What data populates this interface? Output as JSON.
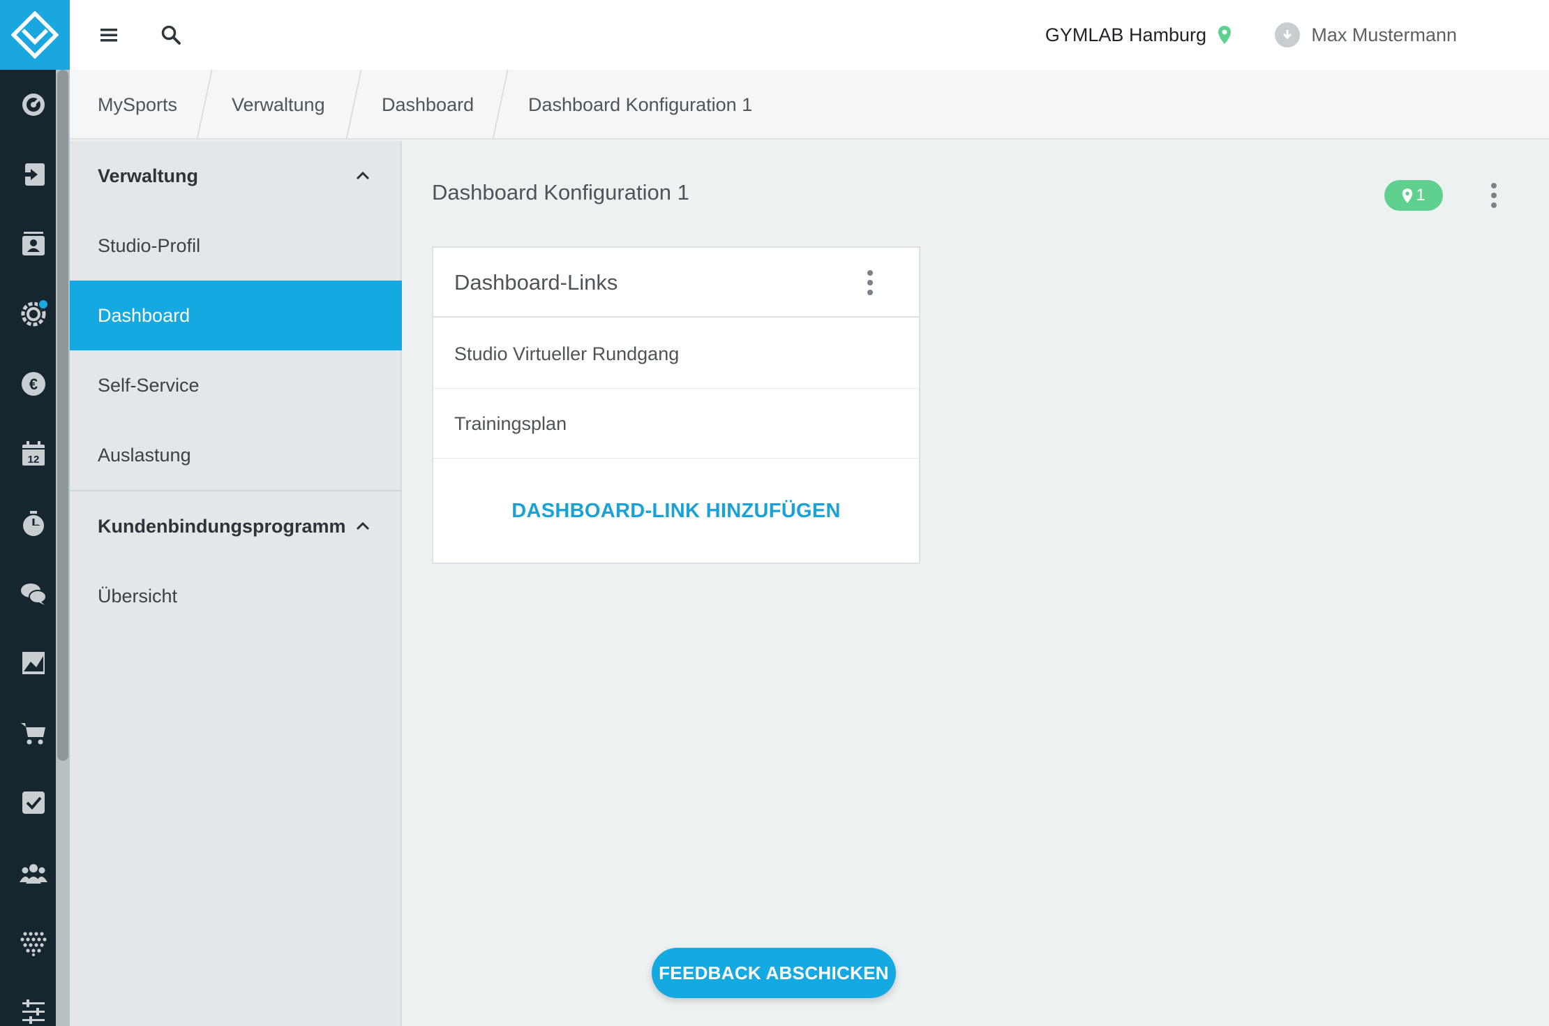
{
  "colors": {
    "accent": "#14a9e1",
    "rail_bg": "#16262f",
    "badge_green": "#5fd08e",
    "location_pin": "#5fd08e"
  },
  "rail": {
    "logo": "brand-logo",
    "icons": [
      "dashboard-gauge-icon",
      "check-in-icon",
      "member-card-icon",
      "settings-gear-icon",
      "euro-icon",
      "calendar-icon",
      "stopwatch-icon",
      "chat-icon",
      "image-icon",
      "shopping-cart-icon",
      "checkbox-icon",
      "group-icon",
      "dots-grid-icon",
      "sliders-icon"
    ]
  },
  "topbar": {
    "studio_name": "GYMLAB Hamburg",
    "user_name": "Max Mustermann"
  },
  "breadcrumb": [
    "MySports",
    "Verwaltung",
    "Dashboard",
    "Dashboard Konfiguration 1"
  ],
  "sidebar": {
    "section1_title": "Verwaltung",
    "section1_items": [
      "Studio-Profil",
      "Dashboard",
      "Self-Service",
      "Auslastung"
    ],
    "section2_title": "Kundenbindungsprogramm",
    "section2_items": [
      "Übersicht"
    ],
    "active_item": "Dashboard"
  },
  "main": {
    "title": "Dashboard Konfiguration 1",
    "location_count": "1",
    "card": {
      "title": "Dashboard-Links",
      "rows": [
        "Studio Virtueller Rundgang",
        "Trainingsplan"
      ],
      "add_label": "DASHBOARD-LINK HINZUFÜGEN"
    }
  },
  "feedback_label": "FEEDBACK ABSCHICKEN"
}
